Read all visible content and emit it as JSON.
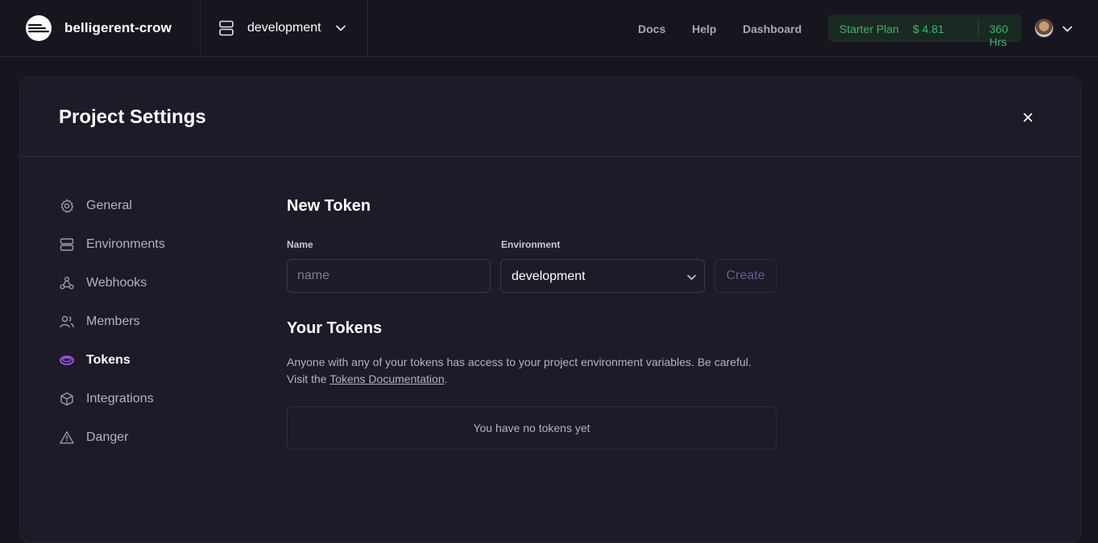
{
  "topbar": {
    "project_name": "belligerent-crow",
    "environment": "development",
    "nav": [
      {
        "label": "Docs"
      },
      {
        "label": "Help"
      },
      {
        "label": "Dashboard"
      }
    ],
    "plan": {
      "name": "Starter Plan",
      "cost": "$ 4.81",
      "hours": "360 Hrs",
      "color": "#3fb36e"
    }
  },
  "panel": {
    "title": "Project Settings",
    "sidebar": [
      {
        "label": "General",
        "icon": "gear-icon"
      },
      {
        "label": "Environments",
        "icon": "server-icon"
      },
      {
        "label": "Webhooks",
        "icon": "webhook-icon"
      },
      {
        "label": "Members",
        "icon": "users-icon"
      },
      {
        "label": "Tokens",
        "icon": "token-icon",
        "active": true
      },
      {
        "label": "Integrations",
        "icon": "cube-icon"
      },
      {
        "label": "Danger",
        "icon": "warning-icon"
      }
    ],
    "new_token": {
      "title": "New Token",
      "name_label": "Name",
      "name_placeholder": "name",
      "name_value": "",
      "env_label": "Environment",
      "env_value": "development",
      "create_label": "Create"
    },
    "your_tokens": {
      "title": "Your Tokens",
      "desc_before": "Anyone with any of your tokens has access to your project environment variables. Be careful. Visit the ",
      "desc_link": "Tokens Documentation",
      "desc_after": ".",
      "empty": "You have no tokens yet"
    }
  },
  "colors": {
    "background": "#17161f",
    "panel": "#1c1b27",
    "accent": "#a855f7",
    "plan_green": "#3fb36e"
  }
}
